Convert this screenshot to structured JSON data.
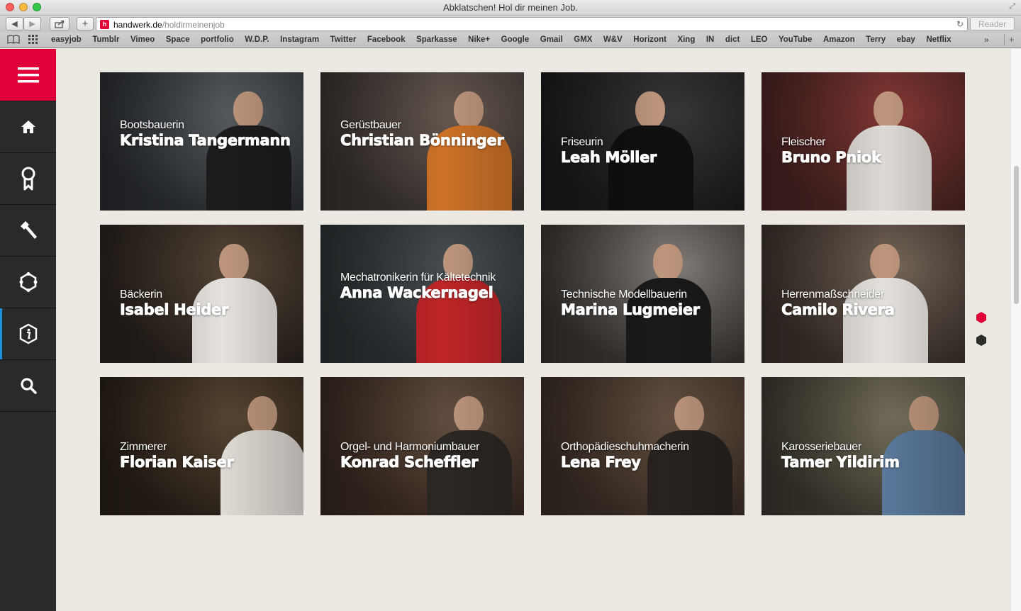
{
  "browser": {
    "window_title": "Abklatschen! Hol dir meinen Job.",
    "url_host": "handwerk.de",
    "url_path": "/holdirmeinenjob",
    "reader_label": "Reader",
    "bookmarks": [
      "easyjob",
      "Tumblr",
      "Vimeo",
      "Space",
      "portfolio",
      "W.D.P.",
      "Instagram",
      "Twitter",
      "Facebook",
      "Sparkasse",
      "Nike+",
      "Google",
      "Gmail",
      "GMX",
      "W&V",
      "Horizont",
      "Xing",
      "IN",
      "dict",
      "LEO",
      "YouTube",
      "Amazon",
      "Terry",
      "ebay",
      "Netflix"
    ]
  },
  "sidebar": {
    "accent_color": "#e2003b",
    "active_color": "#1f8ed8",
    "items": [
      {
        "icon": "menu-icon"
      },
      {
        "icon": "home-icon"
      },
      {
        "icon": "award-icon"
      },
      {
        "icon": "hammer-icon"
      },
      {
        "icon": "puzzle-icon"
      },
      {
        "icon": "info-icon",
        "active": true
      },
      {
        "icon": "search-icon"
      }
    ]
  },
  "tiles": [
    {
      "job": "Bootsbauerin",
      "name": "Kristina Tangermann"
    },
    {
      "job": "Gerüstbauer",
      "name": "Christian Bönninger"
    },
    {
      "job": "Friseurin",
      "name": "Leah Möller"
    },
    {
      "job": "Fleischer",
      "name": "Bruno Pniok"
    },
    {
      "job": "Bäckerin",
      "name": "Isabel Heider"
    },
    {
      "job": "Mechatronikerin für Kältetechnik",
      "name": "Anna Wackernagel"
    },
    {
      "job": "Technische Modellbauerin",
      "name": "Marina Lugmeier"
    },
    {
      "job": "Herrenmaßschneider",
      "name": "Camilo Rivera"
    },
    {
      "job": "Zimmerer",
      "name": "Florian Kaiser"
    },
    {
      "job": "Orgel- und Harmoniumbauer",
      "name": "Konrad Scheffler"
    },
    {
      "job": "Orthopädieschuhmacherin",
      "name": "Lena Frey"
    },
    {
      "job": "Karosseriebauer",
      "name": "Tamer Yildirim"
    }
  ],
  "pager": {
    "active_color": "#e2003b",
    "inactive_color": "#2b2b2b",
    "pages": 2,
    "current": 1
  }
}
